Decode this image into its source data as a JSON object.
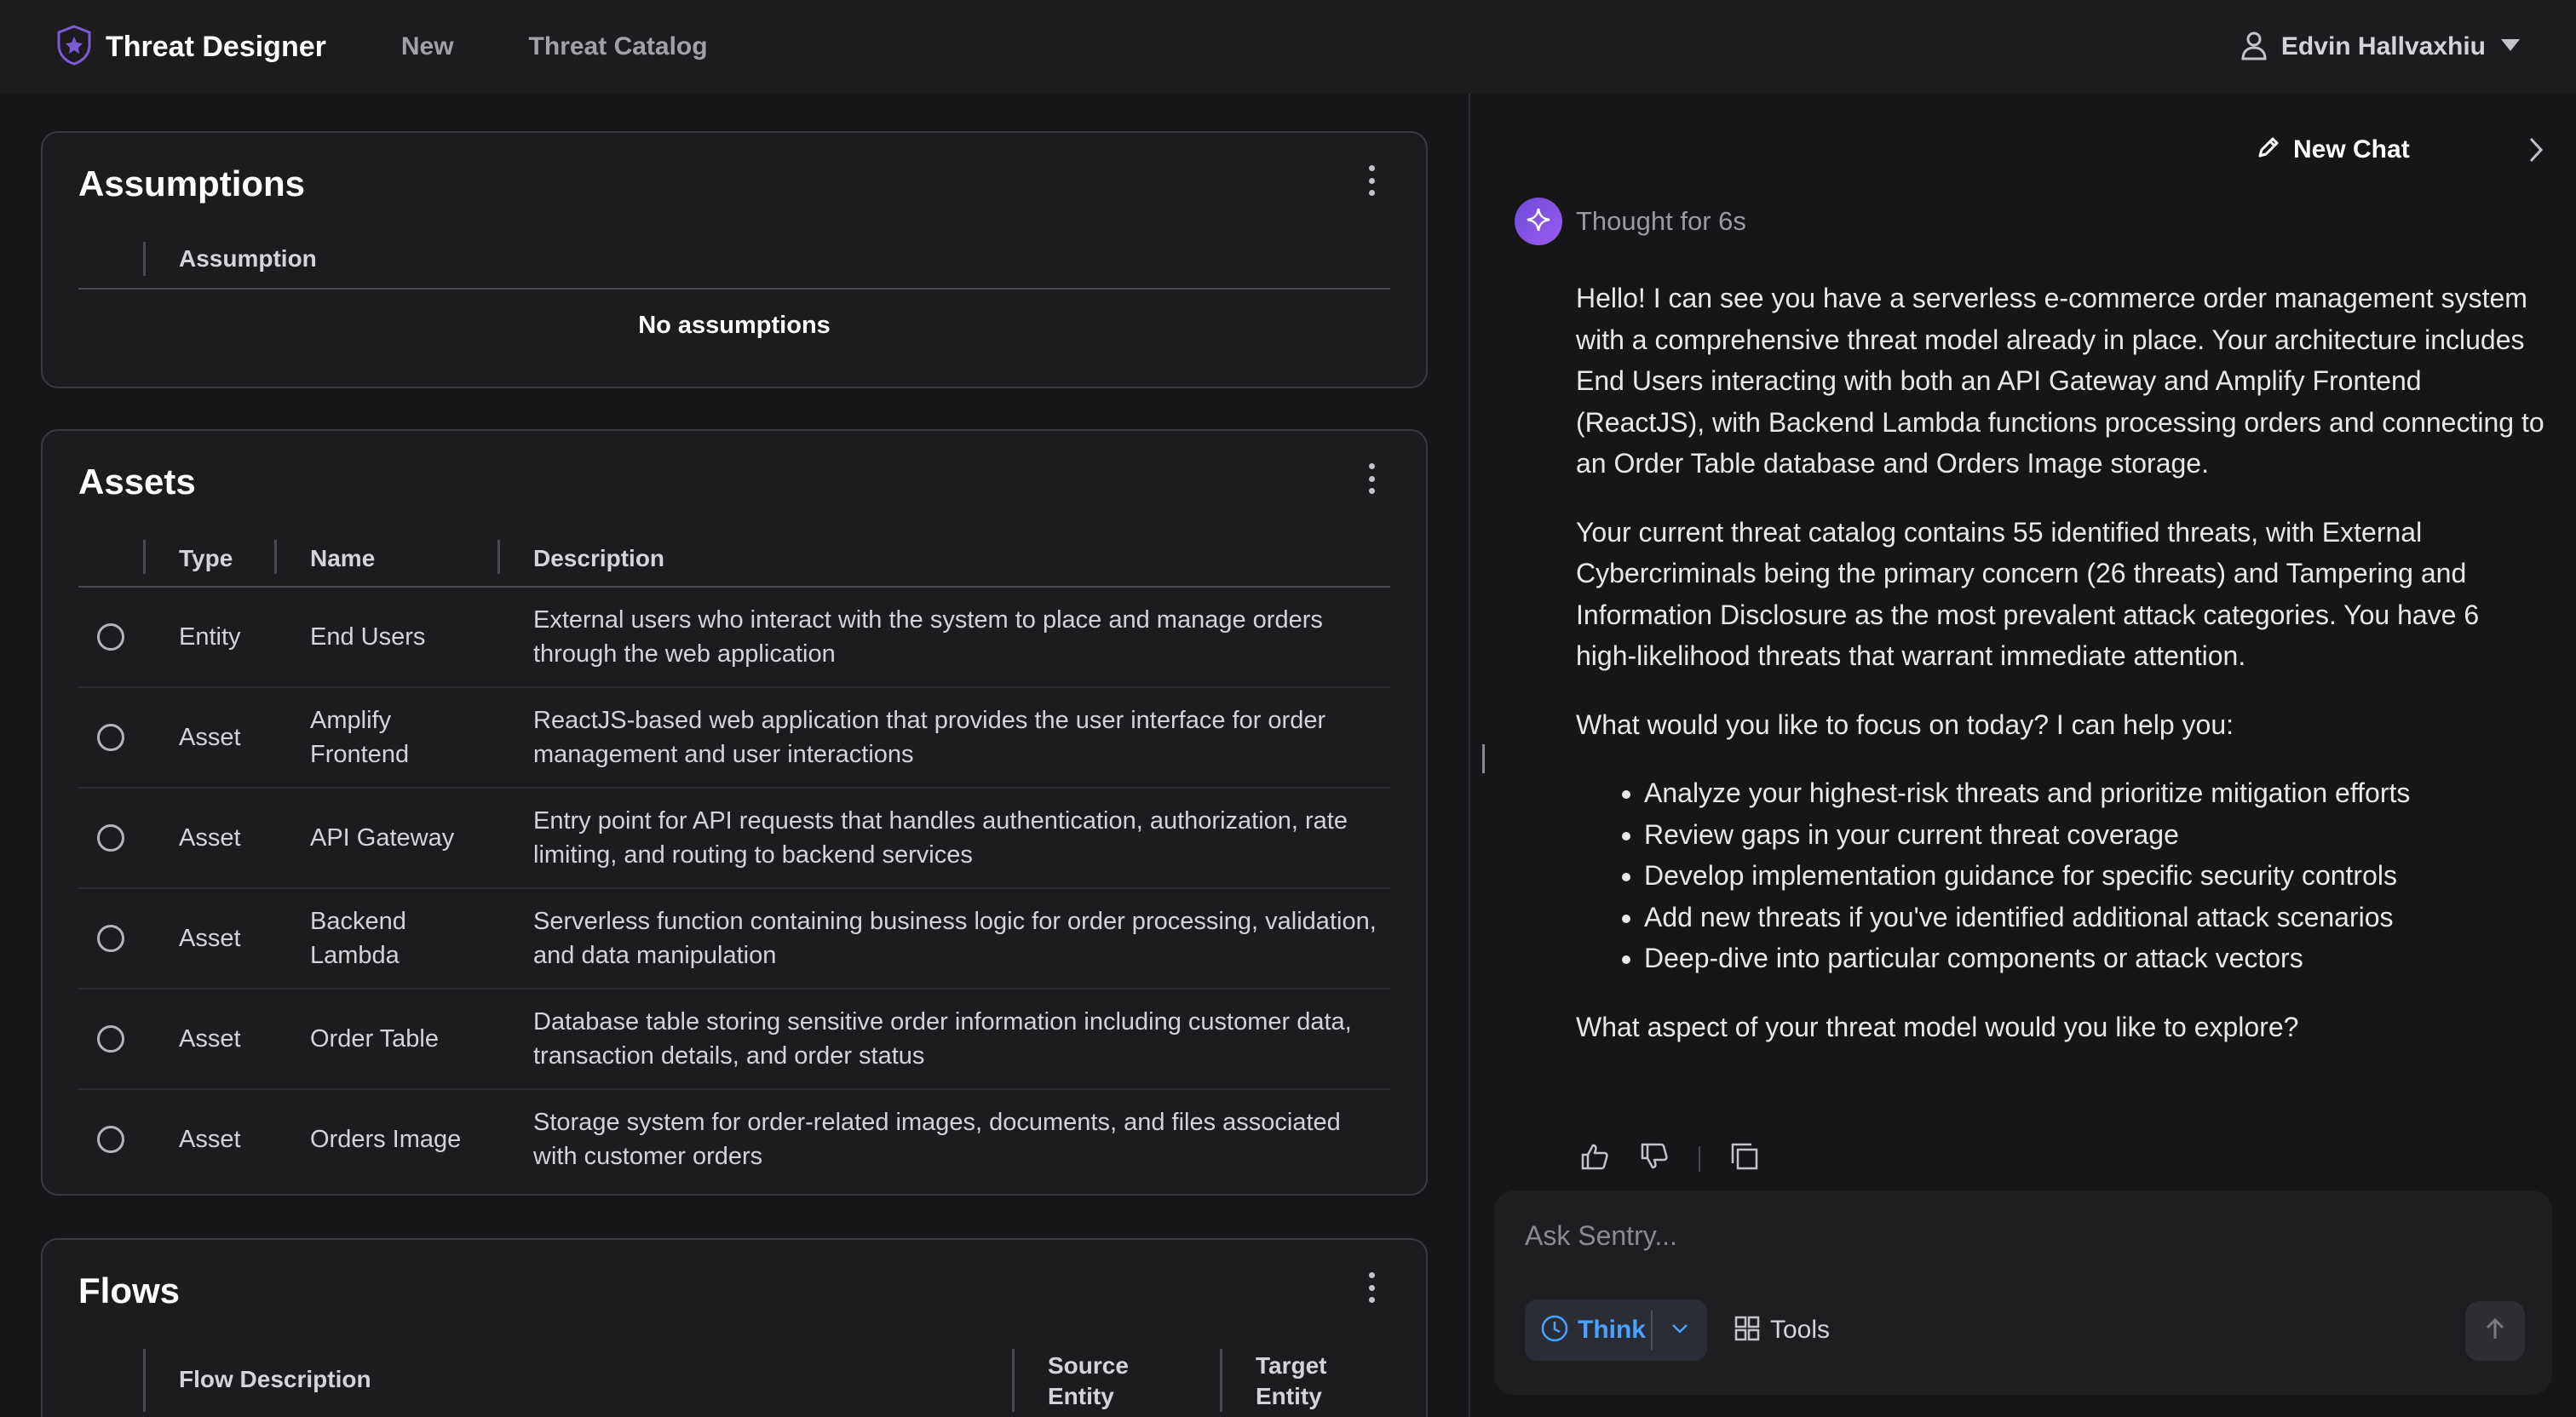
{
  "header": {
    "app_title": "Threat Designer",
    "nav": [
      "New",
      "Threat Catalog"
    ],
    "user_name": "Edvin Hallvaxhiu",
    "icons": {
      "logo": "shield-logo-icon",
      "user": "user-icon",
      "caret": "caret-down-icon"
    }
  },
  "assumptions": {
    "title": "Assumptions",
    "columns": [
      "Assumption"
    ],
    "empty_text": "No assumptions"
  },
  "assets": {
    "title": "Assets",
    "columns": [
      "Type",
      "Name",
      "Description"
    ],
    "rows": [
      {
        "type": "Entity",
        "name": "End Users",
        "description": "External users who interact with the system to place and manage orders through the web application"
      },
      {
        "type": "Asset",
        "name": "Amplify Frontend",
        "description": "ReactJS-based web application that provides the user interface for order management and user interactions"
      },
      {
        "type": "Asset",
        "name": "API Gateway",
        "description": "Entry point for API requests that handles authentication, authorization, rate limiting, and routing to backend services"
      },
      {
        "type": "Asset",
        "name": "Backend Lambda",
        "description": "Serverless function containing business logic for order processing, validation, and data manipulation"
      },
      {
        "type": "Asset",
        "name": "Order Table",
        "description": "Database table storing sensitive order information including customer data, transaction details, and order status"
      },
      {
        "type": "Asset",
        "name": "Orders Image",
        "description": "Storage system for order-related images, documents, and files associated with customer orders"
      }
    ]
  },
  "flows": {
    "title": "Flows",
    "columns": [
      "Flow Description",
      "Source Entity",
      "Target Entity"
    ]
  },
  "chat": {
    "new_chat_label": "New Chat",
    "thought_label": "Thought for 6s",
    "paragraphs": [
      "Hello! I can see you have a serverless e-commerce order management system with a comprehensive threat model already in place. Your architecture includes End Users interacting with both an API Gateway and Amplify Frontend (ReactJS), with Backend Lambda functions processing orders and connecting to an Order Table database and Orders Image storage.",
      "Your current threat catalog contains 55 identified threats, with External Cybercriminals being the primary concern (26 threats) and Tampering and Information Disclosure as the most prevalent attack categories. You have 6 high-likelihood threats that warrant immediate attention.",
      "What would you like to focus on today? I can help you:"
    ],
    "bullets": [
      "Analyze your highest-risk threats and prioritize mitigation efforts",
      "Review gaps in your current threat coverage",
      "Develop implementation guidance for specific security controls",
      "Add new threats if you've identified additional attack scenarios",
      "Deep-dive into particular components or attack vectors"
    ],
    "closing": "What aspect of your threat model would you like to explore?",
    "input_placeholder": "Ask Sentry...",
    "input_value": "",
    "think_label": "Think",
    "tools_label": "Tools"
  },
  "colors": {
    "background": "#161618",
    "panel": "#1c1c1f",
    "accent": "#4aa3ff",
    "avatar": "#7c4ddf"
  }
}
